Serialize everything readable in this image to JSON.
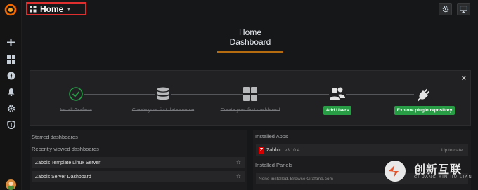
{
  "navbar": {
    "dashboard_picker": "Home"
  },
  "page": {
    "title": "Home Dashboard"
  },
  "getting_started": {
    "steps": [
      {
        "label": "Install Grafana"
      },
      {
        "label": "Create your first data source"
      },
      {
        "label": "Create your first dashboard"
      },
      {
        "button": "Add Users"
      },
      {
        "button": "Explore plugin repository"
      }
    ],
    "close": "×"
  },
  "left_column": {
    "starred_heading": "Starred dashboards",
    "recent_heading": "Recently viewed dashboards",
    "recent": [
      {
        "name": "Zabbix Template Linux Server"
      },
      {
        "name": "Zabbix Server Dashboard"
      }
    ]
  },
  "right_column": {
    "apps_heading": "Installed Apps",
    "apps": [
      {
        "badge": "Z",
        "name": "Zabbix",
        "version": "v3.10.4",
        "status": "Up to date"
      }
    ],
    "panels_heading": "Installed Panels",
    "panels_empty": "None installed. Browse Grafana.com"
  },
  "watermark": {
    "cn": "创新互联",
    "en": "CHUANG XIN HU LIAN"
  },
  "colors": {
    "accent": "#e02f2f",
    "primary_green": "#299c46",
    "underline": "#b56b10",
    "background": "#161719"
  }
}
